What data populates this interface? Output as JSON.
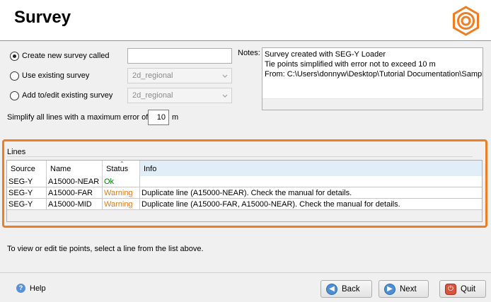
{
  "header": {
    "title": "Survey"
  },
  "form": {
    "options": [
      {
        "label": "Create new survey called",
        "checked": true,
        "value": ""
      },
      {
        "label": "Use existing survey",
        "checked": false,
        "value": "2d_regional"
      },
      {
        "label": "Add to/edit existing survey",
        "checked": false,
        "value": "2d_regional"
      }
    ],
    "notes_label": "Notes:",
    "notes_lines": [
      "Survey created with SEG-Y Loader",
      "Tie points simplified with error not to exceed 10 m",
      "From: C:\\Users\\donnyw\\Desktop\\Tutorial Documentation\\Sample"
    ],
    "simplify_label": "Simplify all lines with a maximum error of",
    "simplify_value": "10",
    "simplify_unit": "m"
  },
  "lines": {
    "label": "Lines",
    "columns": [
      "Source",
      "Name",
      "Status",
      "Info"
    ],
    "rows": [
      {
        "source": "SEG-Y",
        "name": "A15000-NEAR",
        "status": "Ok",
        "info": ""
      },
      {
        "source": "SEG-Y",
        "name": "A15000-FAR",
        "status": "Warning",
        "info": "Duplicate line (A15000-NEAR). Check the manual for details."
      },
      {
        "source": "SEG-Y",
        "name": "A15000-MID",
        "status": "Warning",
        "info": "Duplicate line (A15000-FAR, A15000-NEAR). Check the manual for details."
      }
    ]
  },
  "hint": "To view or edit tie points, select a line from the list above.",
  "footer": {
    "help": "Help",
    "back": "Back",
    "next": "Next",
    "quit": "Quit"
  },
  "colors": {
    "accent": "#ef7d22",
    "ok": "#008000",
    "warning": "#e07b1a"
  }
}
